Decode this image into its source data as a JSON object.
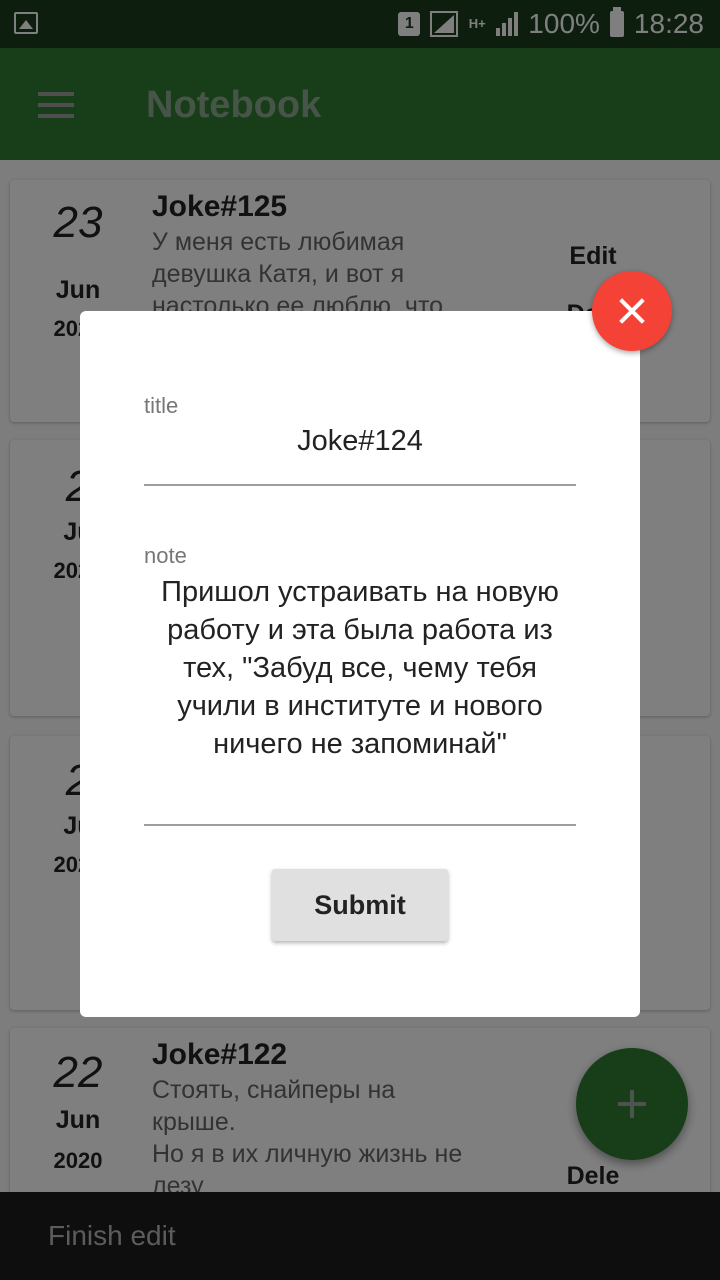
{
  "status_bar": {
    "sim": "1",
    "hplus": "H+",
    "battery": "100%",
    "time": "18:28"
  },
  "app_bar": {
    "title": "Notebook"
  },
  "notes": [
    {
      "day": "23",
      "month": "Jun",
      "year": "2020",
      "title": "Joke#125",
      "body": "У меня есть любимая девушка Катя, и вот я настолько ее люблю, что",
      "edit": "Edit",
      "delete": "Dele"
    },
    {
      "day": "2",
      "month": "Ju",
      "year": "2020",
      "title": "",
      "body": "",
      "edit": "",
      "delete": ""
    },
    {
      "day": "2",
      "month": "Ju",
      "year": "2020",
      "title": "",
      "body": "",
      "edit": "",
      "delete": ""
    },
    {
      "day": "22",
      "month": "Jun",
      "year": "2020",
      "title": "Joke#122",
      "body": "Стоять, снайперы на крыше.\nНо я в их личную жизнь не лезу",
      "edit": "E",
      "delete": "Dele"
    }
  ],
  "dialog": {
    "title_label": "title",
    "title_value": "Joke#124",
    "note_label": "note",
    "note_value": "Пришол устраивать на новую работу и эта была работа из тех, \"Забуд все, чему тебя учили в институте и нового ничего не запоминай\"",
    "submit_label": "Submit"
  },
  "bottom_bar": {
    "label": "Finish edit"
  },
  "colors": {
    "primary": "#2e7d32",
    "close": "#f44336",
    "status_bar": "#1b3a1d"
  }
}
